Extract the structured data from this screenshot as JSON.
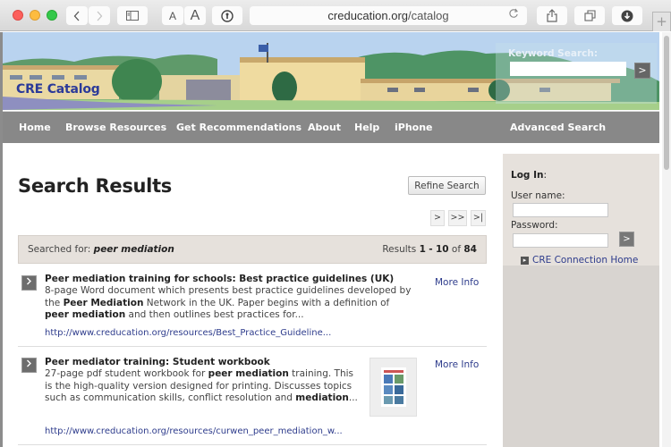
{
  "browser": {
    "url_domain": "creducation.org",
    "url_path": "/catalog",
    "font_small_label": "A",
    "font_large_label": "A",
    "back_icon": "chevron-left",
    "forward_icon": "chevron-right",
    "reload_icon": "reload",
    "new_tab_label": "+"
  },
  "header": {
    "site_title": "CRE Catalog",
    "keyword_search_label": "Keyword Search:",
    "keyword_search_value": "",
    "keyword_go_label": ">"
  },
  "nav": {
    "items": [
      {
        "label": "Home"
      },
      {
        "label": "Browse Resources"
      },
      {
        "label": "Get Recommendations"
      },
      {
        "label": "About"
      },
      {
        "label": "Help"
      },
      {
        "label": "iPhone"
      }
    ],
    "advanced_search": "Advanced Search"
  },
  "main": {
    "title": "Search Results",
    "refine_button": "Refine Search",
    "pagination": {
      "next": ">",
      "skip": ">>",
      "last": ">|"
    },
    "searched_for_label": "Searched for:",
    "searched_for_query": "peer mediation",
    "results_prefix": "Results",
    "results_start": "1",
    "results_sep": "-",
    "results_end": "10",
    "results_of": "of",
    "results_total": "84",
    "results": [
      {
        "title": "Peer mediation training for schools: Best practice guidelines (UK)",
        "description_lines": [
          [
            {
              "t": "8-page Word document which presents best practice guidelines developed by",
              "b": false
            }
          ],
          [
            {
              "t": "the ",
              "b": false
            },
            {
              "t": "Peer Mediation",
              "b": true
            },
            {
              "t": " Network in the UK. Paper begins with a definition of",
              "b": false
            }
          ],
          [
            {
              "t": "peer mediation",
              "b": true
            },
            {
              "t": " and then outlines best practices for...",
              "b": false
            }
          ]
        ],
        "url": "http://www.creducation.org/resources/Best_Practice_Guideline...",
        "more_info": "More Info",
        "has_thumbnail": false
      },
      {
        "title": "Peer mediator training: Student workbook",
        "description_lines": [
          [
            {
              "t": "27-page pdf student workbook for ",
              "b": false
            },
            {
              "t": "peer mediation",
              "b": true
            },
            {
              "t": " training. This",
              "b": false
            }
          ],
          [
            {
              "t": "is the high-quality version designed for printing. Discusses topics",
              "b": false
            }
          ],
          [
            {
              "t": "such as communication skills, conflict resolution and ",
              "b": false
            },
            {
              "t": "mediation",
              "b": true
            },
            {
              "t": "...",
              "b": false
            }
          ]
        ],
        "url": "http://www.creducation.org/resources/curwen_peer_mediation_w...",
        "more_info": "More Info",
        "has_thumbnail": true
      }
    ]
  },
  "sidebar": {
    "login_heading": "Log In",
    "login_colon": ":",
    "username_label": "User name:",
    "username_value": "",
    "password_label": "Password:",
    "password_value": "",
    "login_go": ">",
    "connection_link": "CRE Connection Home"
  },
  "colors": {
    "nav_bg": "#888888",
    "link": "#2e3c8c",
    "site_title": "#2b3a99",
    "panel_bg": "#e6e1dc"
  }
}
